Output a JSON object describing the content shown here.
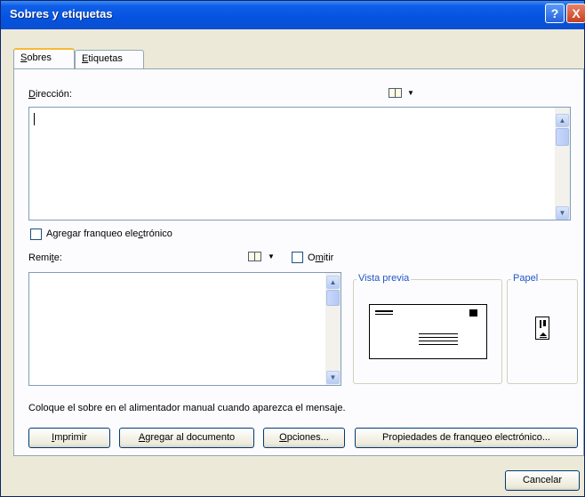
{
  "window": {
    "title": "Sobres y etiquetas",
    "help_glyph": "?",
    "close_glyph": "X"
  },
  "tabs": [
    {
      "label": "Sobres",
      "mnemonic": "S",
      "rest": "obres"
    },
    {
      "label": "Etiquetas",
      "mnemonic": "E",
      "rest": "tiquetas"
    }
  ],
  "direccion": {
    "mnemonic": "D",
    "rest": "irección:",
    "value": ""
  },
  "franqueo_checkbox": {
    "pre": "Agregar franqueo ele",
    "mnemonic": "c",
    "post": "trónico",
    "checked": false
  },
  "remite": {
    "pre": "Remi",
    "mnemonic": "t",
    "post": "e:",
    "value": ""
  },
  "omitir": {
    "pre": "O",
    "mnemonic": "m",
    "post": "itir",
    "checked": false
  },
  "vista_previa": {
    "label": "Vista previa"
  },
  "papel": {
    "label": "Papel"
  },
  "mensaje": "Coloque el sobre en el alimentador manual cuando aparezca el mensaje.",
  "buttons": {
    "imprimir": {
      "mnemonic": "I",
      "rest": "mprimir"
    },
    "agregar": {
      "mnemonic": "A",
      "rest": "gregar al documento"
    },
    "opciones": {
      "mnemonic": "O",
      "rest": "pciones..."
    },
    "propiedades": {
      "pre": "Propiedades de franq",
      "mnemonic": "u",
      "post": "eo electrónico..."
    },
    "cancelar": "Cancelar"
  },
  "icons": [
    "address-book-icon",
    "chevron-down-icon",
    "scroll-up-icon",
    "scroll-down-icon",
    "envelope-preview-icon",
    "paper-feed-icon"
  ]
}
